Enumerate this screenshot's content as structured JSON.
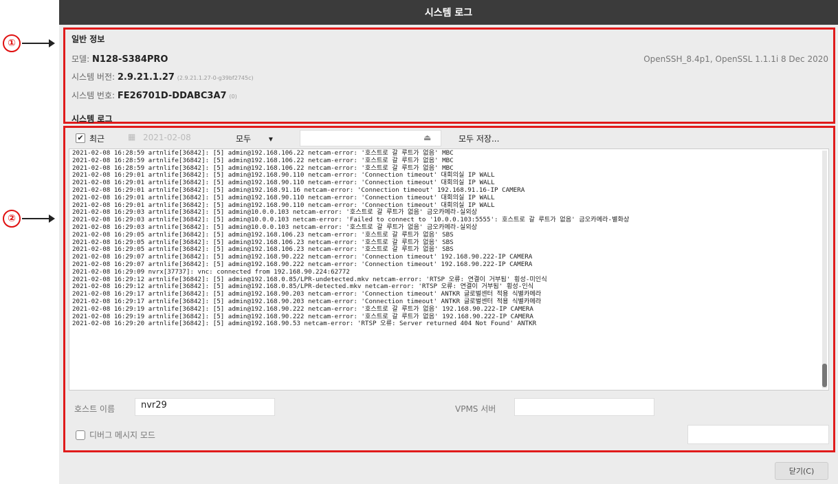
{
  "window": {
    "title": "시스템 로그"
  },
  "callouts": {
    "one": "①",
    "two": "②"
  },
  "general": {
    "title": "일반 정보",
    "model_label": "모델:",
    "model_value": "N128-S384PRO",
    "version_label": "시스템 버전:",
    "version_value": "2.9.21.1.27",
    "version_build": "(2.9.21.1.27-0-g39bf2745c)",
    "serial_label": "시스템 번호:",
    "serial_value": "FE26701D-DDABC3A7",
    "serial_suffix": "(0)",
    "openssh": "OpenSSH_8.4p1, OpenSSL 1.1.1i 8 Dec 2020"
  },
  "syslog": {
    "title": "시스템 로그",
    "recent_label": "최근",
    "date_value": "2021-02-08",
    "filter_value": "모두",
    "filter_arrow": "▾",
    "calendar_icon": "▦",
    "clear_icon": "⏏",
    "save_all_label": "모두 저장...",
    "lines": [
      "2021-02-08 16:28:59 artnlife[36842]: [5] admin@192.168.106.22 netcam-error: '호스트로 갈 루트가 없음' MBC",
      "2021-02-08 16:28:59 artnlife[36842]: [5] admin@192.168.106.22 netcam-error: '호스트로 갈 루트가 없음' MBC",
      "2021-02-08 16:28:59 artnlife[36842]: [5] admin@192.168.106.22 netcam-error: '호스트로 갈 루트가 없음' MBC",
      "2021-02-08 16:29:01 artnlife[36842]: [5] admin@192.168.90.110 netcam-error: 'Connection timeout' 대회의실 IP WALL",
      "2021-02-08 16:29:01 artnlife[36842]: [5] admin@192.168.90.110 netcam-error: 'Connection timeout' 대회의실 IP WALL",
      "2021-02-08 16:29:01 artnlife[36842]: [5] admin@192.168.91.16 netcam-error: 'Connection timeout' 192.168.91.16-IP CAMERA",
      "2021-02-08 16:29:01 artnlife[36842]: [5] admin@192.168.90.110 netcam-error: 'Connection timeout' 대회의실 IP WALL",
      "2021-02-08 16:29:01 artnlife[36842]: [5] admin@192.168.90.110 netcam-error: 'Connection timeout' 대회의실 IP WALL",
      "2021-02-08 16:29:03 artnlife[36842]: [5] admin@10.0.0.103 netcam-error: '호스트로 갈 루트가 없음' 금오카메라-실외상",
      "2021-02-08 16:29:03 artnlife[36842]: [5] admin@10.0.0.103 netcam-error: 'Failed to connect to '10.0.0.103:5555': 호스트로 갈 루트가 없음' 금오카메라-별화상",
      "2021-02-08 16:29:03 artnlife[36842]: [5] admin@10.0.0.103 netcam-error: '호스트로 갈 루트가 없음' 금오카메라-실외상",
      "2021-02-08 16:29:05 artnlife[36842]: [5] admin@192.168.106.23 netcam-error: '호스트로 갈 루트가 없음' SBS",
      "2021-02-08 16:29:05 artnlife[36842]: [5] admin@192.168.106.23 netcam-error: '호스트로 갈 루트가 없음' SBS",
      "2021-02-08 16:29:05 artnlife[36842]: [5] admin@192.168.106.23 netcam-error: '호스트로 갈 루트가 없음' SBS",
      "2021-02-08 16:29:07 artnlife[36842]: [5] admin@192.168.90.222 netcam-error: 'Connection timeout' 192.168.90.222-IP CAMERA",
      "2021-02-08 16:29:07 artnlife[36842]: [5] admin@192.168.90.222 netcam-error: 'Connection timeout' 192.168.90.222-IP CAMERA",
      "2021-02-08 16:29:09 nvrx[37737]: vnc: connected from 192.168.90.224:62772",
      "2021-02-08 16:29:12 artnlife[36842]: [5] admin@192.168.0.85/LPR-undetected.mkv netcam-error: 'RTSP 오류: 연결이 거부됨' 횡성-미인식",
      "2021-02-08 16:29:12 artnlife[36842]: [5] admin@192.168.0.85/LPR-detected.mkv netcam-error: 'RTSP 오류: 연결이 거부됨' 횡성-인식",
      "2021-02-08 16:29:17 artnlife[36842]: [5] admin@192.168.90.203 netcam-error: 'Connection timeout' ANTKR 글로벌센터 적용 식별카메라",
      "2021-02-08 16:29:17 artnlife[36842]: [5] admin@192.168.90.203 netcam-error: 'Connection timeout' ANTKR 글로벌센터 적용 식별카메라",
      "2021-02-08 16:29:19 artnlife[36842]: [5] admin@192.168.90.222 netcam-error: '호스트로 갈 루트가 없음' 192.168.90.222-IP CAMERA",
      "2021-02-08 16:29:19 artnlife[36842]: [5] admin@192.168.90.222 netcam-error: '호스트로 갈 루트가 없음' 192.168.90.222-IP CAMERA",
      "2021-02-08 16:29:20 artnlife[36842]: [5] admin@192.168.90.53 netcam-error: 'RTSP 오류: Server returned 404 Not Found' ANTKR"
    ],
    "host_label": "호스트 이름",
    "host_value": "nvr29",
    "vpms_label": "VPMS 서버",
    "vpms_value": "",
    "debug_label": "디버그 메시지 모드",
    "debug_value": ""
  },
  "footer": {
    "close_label": "닫기(C)"
  },
  "colors": {
    "highlight": "#e01b1b",
    "titlebar": "#3b3b3b"
  }
}
